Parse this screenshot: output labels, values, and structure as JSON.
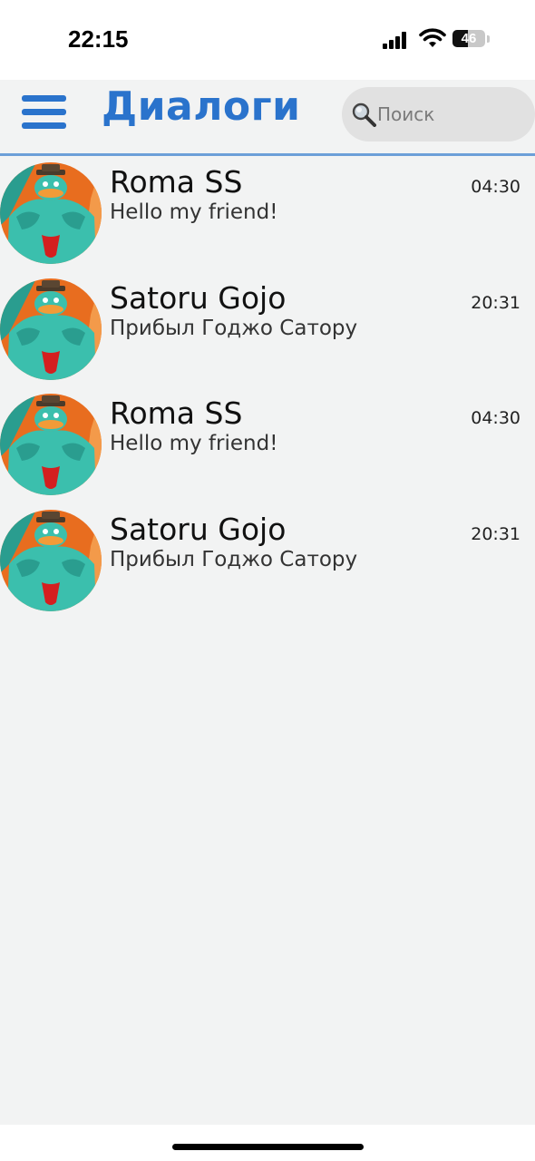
{
  "status_bar": {
    "time": "22:15",
    "battery_level": "46",
    "battery_fraction": 0.46
  },
  "header": {
    "title": "Диалоги",
    "search_placeholder": "Поиск",
    "accent_color": "#2a73cc",
    "menu_icon": "hamburger-menu-icon",
    "search_icon": "magnifier-icon"
  },
  "dialogs": [
    {
      "name": "Roma SS",
      "time": "04:30",
      "preview": "Hello my friend!"
    },
    {
      "name": "Satoru Gojo",
      "time": "20:31",
      "preview": "Прибыл Годжо Сатору"
    },
    {
      "name": "Roma SS",
      "time": "04:30",
      "preview": "Hello my friend!"
    },
    {
      "name": "Satoru Gojo",
      "time": "20:31",
      "preview": "Прибыл Годжо Сатору"
    }
  ]
}
